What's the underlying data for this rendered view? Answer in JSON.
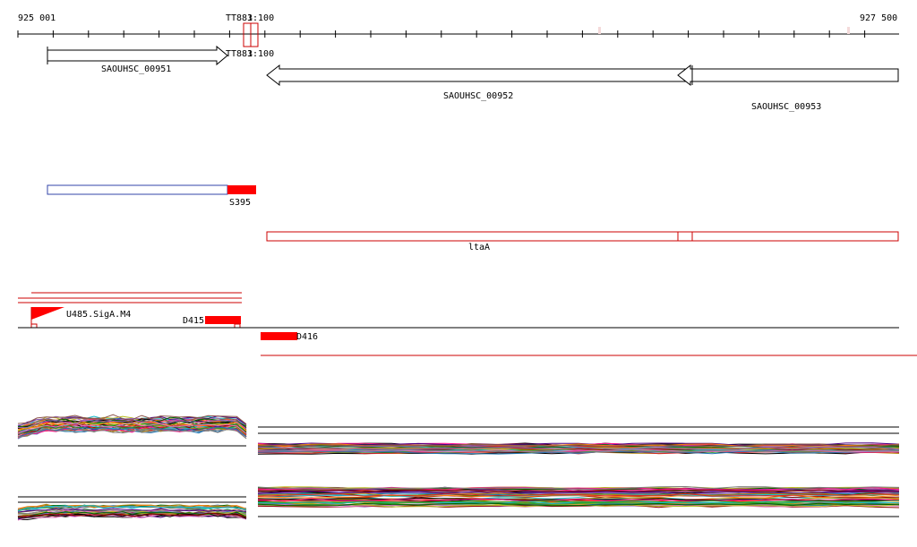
{
  "ruler": {
    "start_label": "925 001",
    "end_label": "927 500",
    "marker_label_top": "TT883",
    "marker_label_top_suffix": "1:100",
    "marker_label_bottom": "TT883",
    "marker_label_bottom_suffix": "1:100"
  },
  "genes": {
    "gene1": "SAOUHSC_00951",
    "gene2": "SAOUHSC_00952",
    "gene3": "SAOUHSC_00953"
  },
  "features": {
    "s_label": "S395",
    "lta_label": "ltaA",
    "motif_label": "U485.SigA.M4",
    "d415_label": "D415",
    "d416_label": "D416"
  },
  "colors": {
    "feature_red": "#ff0000",
    "outline_red": "#cc0000",
    "outline_blue": "#3344aa",
    "axis": "#000000"
  }
}
